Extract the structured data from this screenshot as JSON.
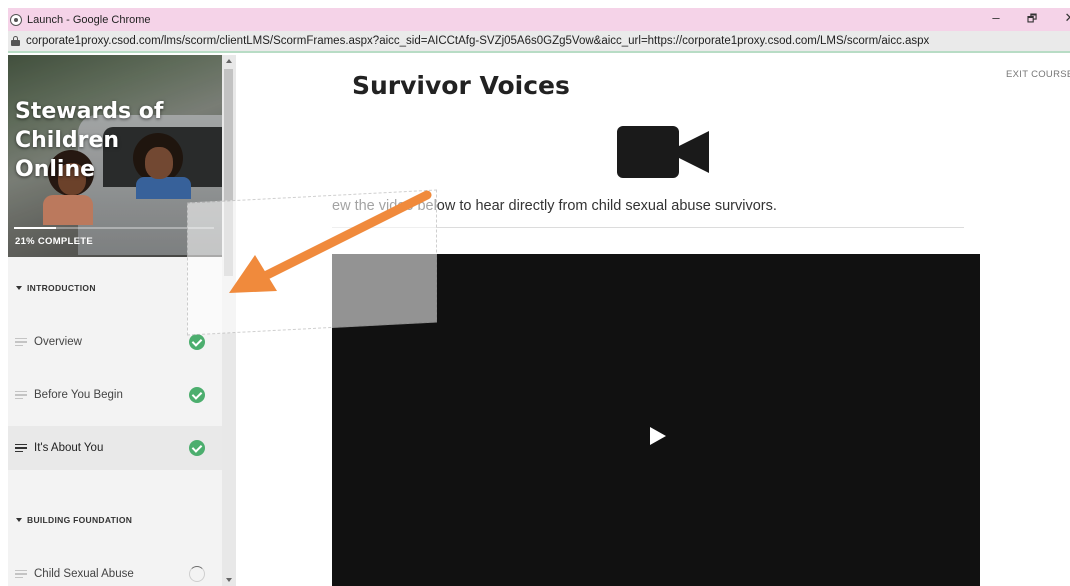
{
  "browser": {
    "window_title": "Launch - Google Chrome",
    "url": "corporate1proxy.csod.com/lms/scorm/clientLMS/ScormFrames.aspx?aicc_sid=AICCtAfg-SVZj05A6s0GZg5Vow&aicc_url=https://corporate1proxy.csod.com/LMS/scorm/aicc.aspx",
    "minimize_glyph": "–",
    "restore_glyph": "🗗",
    "close_glyph": "✕"
  },
  "sidebar": {
    "course_title": "Stewards of Children Online",
    "progress_percent": 21,
    "progress_text": "21% COMPLETE",
    "sections": [
      {
        "title": "INTRODUCTION",
        "lessons": [
          {
            "name": "Overview",
            "status": "complete"
          },
          {
            "name": "Before You Begin",
            "status": "complete"
          },
          {
            "name": "It's About You",
            "status": "complete",
            "active": true
          }
        ]
      },
      {
        "title": "BUILDING FOUNDATION",
        "lessons": [
          {
            "name": "Child Sexual Abuse",
            "status": "in-progress"
          }
        ]
      }
    ]
  },
  "main": {
    "title": "Survivor Voices",
    "exit_label": "EXIT COURSE",
    "instruction": "ew the video below to hear directly from child sexual abuse survivors.",
    "media_icon": "video-camera-icon"
  },
  "colors": {
    "titlebar": "#f5d3e8",
    "complete_green": "#4cae6e",
    "arrow_orange": "#f08a3c",
    "video_bg": "#111111"
  }
}
